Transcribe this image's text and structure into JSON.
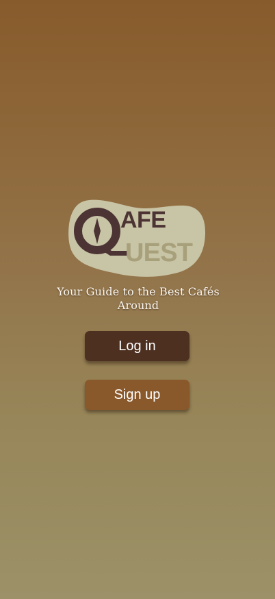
{
  "app": {
    "logo": {
      "name": "CafeQuest",
      "line1": "AFE",
      "line2": "UEST",
      "colors": {
        "blob": "#c8c4a6",
        "dark": "#4d3434",
        "olive": "#a7a07a"
      }
    },
    "tagline": "Your Guide to the Best Cafés Around"
  },
  "buttons": {
    "login_label": "Log in",
    "signup_label": "Sign up"
  },
  "theme": {
    "background_top": "#885b2c",
    "background_bottom": "#9c9168",
    "login_button": "#4d3020",
    "signup_button": "#8a592b",
    "button_text": "#ffffff"
  }
}
